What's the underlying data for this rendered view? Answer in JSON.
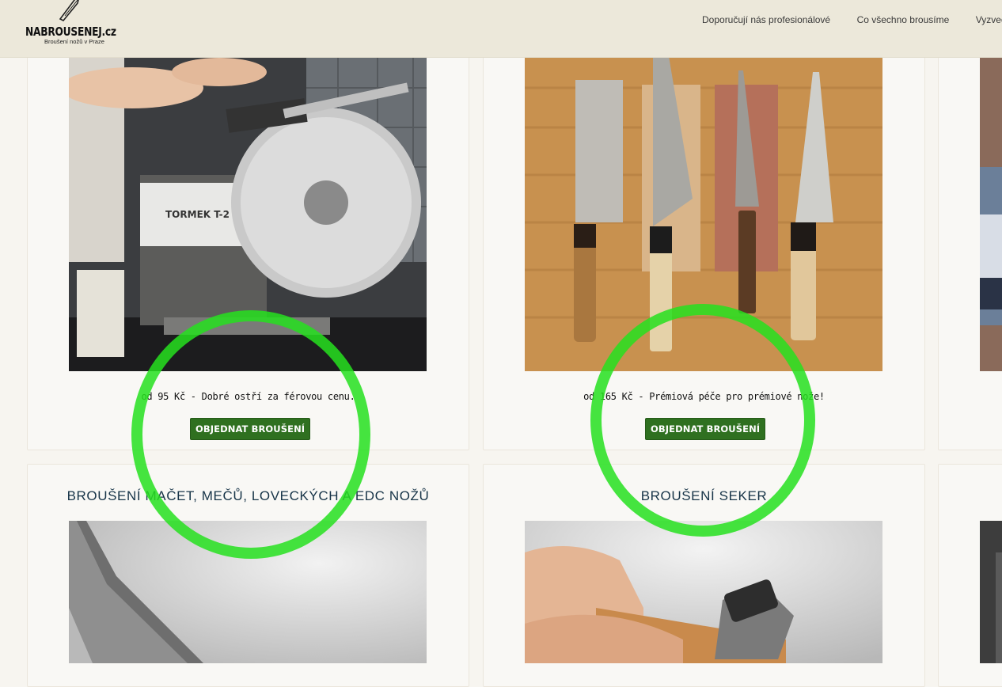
{
  "header": {
    "logo_title": "NABROUSENEJ.cz",
    "logo_subtitle": "Broušení nožů v Praze",
    "nav": [
      {
        "label": "Doporučují nás profesionálové"
      },
      {
        "label": "Co všechno brousíme"
      },
      {
        "label": "Vyzvedn"
      }
    ]
  },
  "cards": [
    {
      "price_text": "od 95 Kč - Dobré ostří za férovou cenu.",
      "button_label": "OBJEDNAT BROUŠENÍ"
    },
    {
      "price_text": "od 165 Kč - Prémiová péče pro prémiové nože!",
      "button_label": "OBJEDNAT BROUŠENÍ"
    },
    {
      "heading": "BROUŠENÍ MAČET, MEČŮ, LOVECKÝCH A EDC NOŽŮ"
    },
    {
      "heading": "BROUŠENÍ SEKER"
    }
  ],
  "colors": {
    "header_bg": "#ece8da",
    "button_bg": "#2f7020",
    "heading_text": "#163347",
    "highlight_circle": "#26e11e"
  }
}
